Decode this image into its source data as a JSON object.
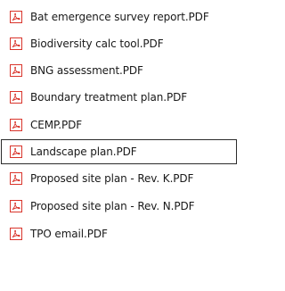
{
  "file_list": {
    "items": [
      {
        "name": "Bat emergence survey report.PDF",
        "icon": "pdf-file-icon",
        "selected": false
      },
      {
        "name": "Biodiversity calc tool.PDF",
        "icon": "pdf-file-icon",
        "selected": false
      },
      {
        "name": "BNG assessment.PDF",
        "icon": "pdf-file-icon",
        "selected": false
      },
      {
        "name": "Boundary treatment plan.PDF",
        "icon": "pdf-file-icon",
        "selected": false
      },
      {
        "name": "CEMP.PDF",
        "icon": "pdf-file-icon",
        "selected": false
      },
      {
        "name": "Landscape plan.PDF",
        "icon": "pdf-file-icon",
        "selected": true
      },
      {
        "name": "Proposed site plan - Rev. K.PDF",
        "icon": "pdf-file-icon",
        "selected": false
      },
      {
        "name": "Proposed site plan - Rev. N.PDF",
        "icon": "pdf-file-icon",
        "selected": false
      },
      {
        "name": "TPO email.PDF",
        "icon": "pdf-file-icon",
        "selected": false
      }
    ]
  },
  "colors": {
    "pdf_icon": "#d9342b",
    "selection_border": "#2b2b2b",
    "text": "#1a1a1a"
  }
}
